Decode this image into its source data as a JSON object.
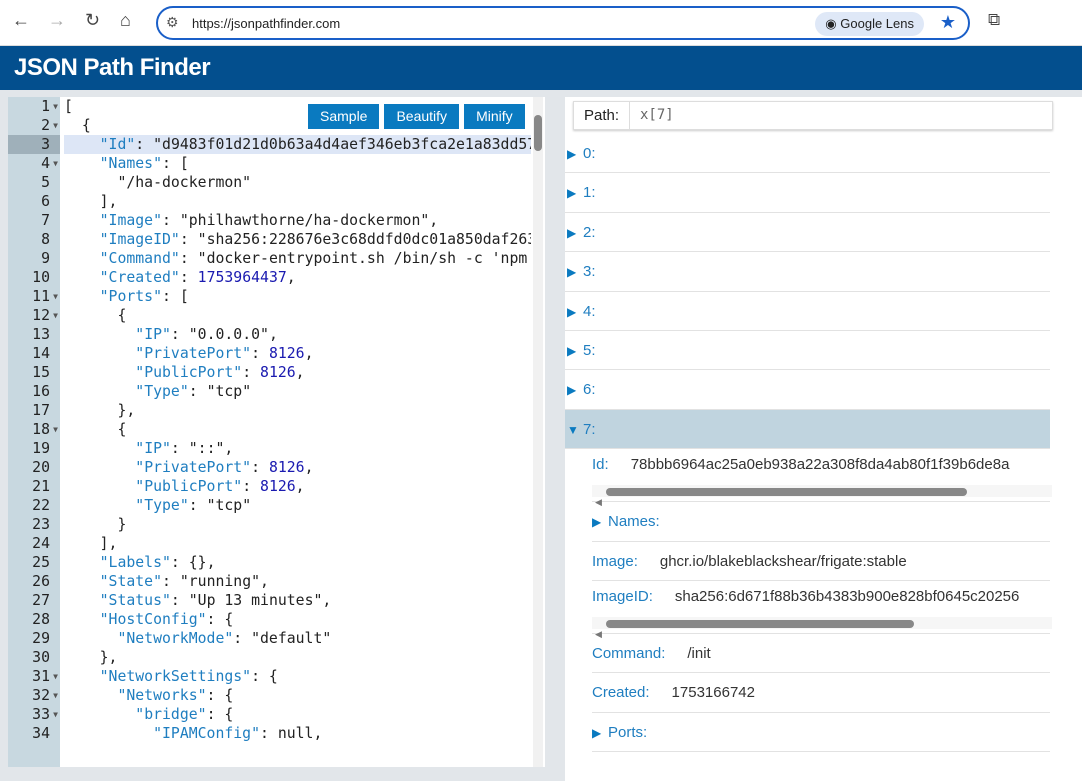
{
  "browser": {
    "url": "https://jsonpathfinder.com",
    "lens_label": "Google Lens"
  },
  "app": {
    "title": "JSON Path Finder"
  },
  "editor": {
    "buttons": [
      "Sample",
      "Beautify",
      "Minify"
    ],
    "active_line": 3,
    "folds": [
      1,
      2,
      4,
      11,
      12,
      18,
      31,
      32,
      33
    ],
    "lines": [
      "[",
      "  {",
      "    \"Id\": \"d9483f01d21d0b63a4d4aef346eb3fca2e1a83dd57",
      "    \"Names\": [",
      "      \"/ha-dockermon\"",
      "    ],",
      "    \"Image\": \"philhawthorne/ha-dockermon\",",
      "    \"ImageID\": \"sha256:228676e3c68ddfd0dc01a850daf263",
      "    \"Command\": \"docker-entrypoint.sh /bin/sh -c 'npm",
      "    \"Created\": 1753964437,",
      "    \"Ports\": [",
      "      {",
      "        \"IP\": \"0.0.0.0\",",
      "        \"PrivatePort\": 8126,",
      "        \"PublicPort\": 8126,",
      "        \"Type\": \"tcp\"",
      "      },",
      "      {",
      "        \"IP\": \"::\",",
      "        \"PrivatePort\": 8126,",
      "        \"PublicPort\": 8126,",
      "        \"Type\": \"tcp\"",
      "      }",
      "    ],",
      "    \"Labels\": {},",
      "    \"State\": \"running\",",
      "    \"Status\": \"Up 13 minutes\",",
      "    \"HostConfig\": {",
      "      \"NetworkMode\": \"default\"",
      "    },",
      "    \"NetworkSettings\": {",
      "      \"Networks\": {",
      "        \"bridge\": {",
      "          \"IPAMConfig\": null,"
    ]
  },
  "path": {
    "label": "Path:",
    "value": "x[7]"
  },
  "tree": {
    "items": [
      "0:",
      "1:",
      "2:",
      "3:",
      "4:",
      "5:",
      "6:",
      "7:"
    ],
    "selected": 7,
    "details": [
      {
        "key": "Id:",
        "value": "78bbb6964ac25a0eb938a22a308f8da4ab80f1f39b6de8a",
        "scroll": 0.82
      },
      {
        "key": "Names:",
        "collapsed": true
      },
      {
        "key": "Image:",
        "value": "ghcr.io/blakeblackshear/frigate:stable"
      },
      {
        "key": "ImageID:",
        "value": "sha256:6d671f88b36b4383b900e828bf0645c20256",
        "scroll": 0.7
      },
      {
        "key": "Command:",
        "value": "/init"
      },
      {
        "key": "Created:",
        "value": "1753166742"
      },
      {
        "key": "Ports:",
        "collapsed": true
      }
    ]
  }
}
